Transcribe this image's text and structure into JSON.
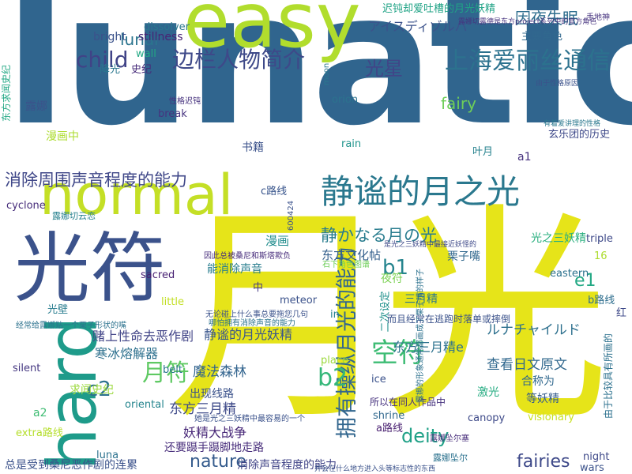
{
  "cloud": {
    "words": [
      {
        "text": "lunatic",
        "color": "#30658e",
        "rotated": false
      },
      {
        "text": "月光",
        "color": "#e6e419",
        "rotated": false
      },
      {
        "text": "easy",
        "color": "#b1dd2d",
        "rotated": false
      },
      {
        "text": "hard",
        "color": "#1e9b8a",
        "rotated": true
      },
      {
        "text": "normal",
        "color": "#c4df26",
        "rotated": false
      },
      {
        "text": "光符",
        "color": "#3b528b",
        "rotated": false
      },
      {
        "text": "静谧的月之光",
        "color": "#2a788e",
        "rotated": false
      },
      {
        "text": "拥有操纵月光的能力",
        "color": "#31668e",
        "rotated": true
      },
      {
        "text": "上海爱丽丝通信",
        "color": "#2c728e",
        "rotated": false
      },
      {
        "text": "边栏人物简介",
        "color": "#3e4989",
        "rotated": false
      },
      {
        "text": "消除周围声音程度的能力",
        "color": "#3f4788",
        "rotated": false
      },
      {
        "text": "静かなる月の光",
        "color": "#287c8e",
        "rotated": false
      },
      {
        "text": "因夜失眠",
        "color": "#2e6e8e",
        "rotated": false
      },
      {
        "text": "光星",
        "color": "#404688",
        "rotated": false
      },
      {
        "text": "空符",
        "color": "#3dbc74",
        "rotated": false
      },
      {
        "text": "月符",
        "color": "#5ec962",
        "rotated": false
      },
      {
        "text": "child",
        "color": "#404387",
        "rotated": false
      },
      {
        "text": "lunar",
        "color": "#2b748e",
        "rotated": false
      },
      {
        "text": "fairy",
        "color": "#6ece58",
        "rotated": false
      },
      {
        "text": "b1",
        "color": "#25848e",
        "rotated": false
      },
      {
        "text": "b2",
        "color": "#35b779",
        "rotated": false
      },
      {
        "text": "c2",
        "color": "#2c718e",
        "rotated": false
      },
      {
        "text": "e1",
        "color": "#22a884",
        "rotated": false
      },
      {
        "text": "deity",
        "color": "#1fa187",
        "rotated": false
      },
      {
        "text": "nature",
        "color": "#365c8d",
        "rotated": false
      },
      {
        "text": "fairies",
        "color": "#3e4989",
        "rotated": false
      },
      {
        "text": "アイスディゾルバ",
        "color": "#3b528b",
        "rotated": false
      },
      {
        "text": "ルナチャイルド",
        "color": "#2d708e",
        "rotated": false
      },
      {
        "text": "东方三月精e",
        "color": "#2c728e",
        "rotated": false
      },
      {
        "text": "东方三月精",
        "color": "#3e4a89",
        "rotated": false
      },
      {
        "text": "东方文化帖",
        "color": "#35608d",
        "rotated": false
      },
      {
        "text": "魔法森林",
        "color": "#32648e",
        "rotated": false
      },
      {
        "text": "查看日文原文",
        "color": "#31688e",
        "rotated": false
      },
      {
        "text": "静谧的月光妖精",
        "color": "#39568c",
        "rotated": false
      },
      {
        "text": "赌上性命去恶作剧",
        "color": "#414487",
        "rotated": false
      },
      {
        "text": "寒冰熔解器",
        "color": "#2d708e",
        "rotated": false
      },
      {
        "text": "妖精大战争",
        "color": "#482878",
        "rotated": false
      },
      {
        "text": "出现线路",
        "color": "#3b528b",
        "rotated": false
      },
      {
        "text": "还要蹑手蹑脚地走路",
        "color": "#472d7b",
        "rotated": false
      },
      {
        "text": "消除声音程度的能力",
        "color": "#414487",
        "rotated": false
      },
      {
        "text": "总是受到桑尼恶作剧的连累",
        "color": "#3b528b",
        "rotated": false
      },
      {
        "text": "迟钝却爱吐槽的月光妖精",
        "color": "#20a386",
        "rotated": false
      },
      {
        "text": "能消除声音",
        "color": "#287d8e",
        "rotated": false
      },
      {
        "text": "栗子嘴",
        "color": "#31688e",
        "rotated": false
      },
      {
        "text": "三月精",
        "color": "#2a768e",
        "rotated": false
      },
      {
        "text": "光之三妖精",
        "color": "#29af7f",
        "rotated": false
      },
      {
        "text": "玄乐团的历史",
        "color": "#3e4989",
        "rotated": false
      },
      {
        "text": "合称为",
        "color": "#31688e",
        "rotated": false
      },
      {
        "text": "等妖精",
        "color": "#365d8d",
        "rotated": false
      },
      {
        "text": "书籍",
        "color": "#3b528b",
        "rotated": false
      },
      {
        "text": "漫画",
        "color": "#228d8d",
        "rotated": false
      },
      {
        "text": "漫画中",
        "color": "#addc30",
        "rotated": false
      },
      {
        "text": "叶月",
        "color": "#26828e",
        "rotated": false
      },
      {
        "text": "主要角色",
        "color": "#31688e",
        "rotated": false
      },
      {
        "text": "露娜",
        "color": "#3b528b",
        "rotated": false
      },
      {
        "text": "降光",
        "color": "#2a778e",
        "rotated": false
      },
      {
        "text": "光壁",
        "color": "#287c8e",
        "rotated": false
      },
      {
        "text": "夜符",
        "color": "#7ad151",
        "rotated": false
      },
      {
        "text": "激光",
        "color": "#25ac82",
        "rotated": false
      },
      {
        "text": "求闻史纪",
        "color": "#9bd93c",
        "rotated": false
      },
      {
        "text": "史纪",
        "color": "#472c7a",
        "rotated": false
      },
      {
        "text": "二次设定",
        "color": "#21918c",
        "rotated": true
      },
      {
        "text": "a路线",
        "color": "#481f70",
        "rotated": false
      },
      {
        "text": "b路线",
        "color": "#2e6e8e",
        "rotated": false
      },
      {
        "text": "c路线",
        "color": "#39558c",
        "rotated": false
      },
      {
        "text": "extra路线",
        "color": "#b5de2b",
        "rotated": false
      },
      {
        "text": "所以在同人作品中",
        "color": "#46327e",
        "rotated": false
      },
      {
        "text": "而且经常在逃跑时落单或摔倒",
        "color": "#3b528b",
        "rotated": false
      },
      {
        "text": "露娜切云恋",
        "color": "#27808e",
        "rotated": false
      },
      {
        "text": "bright",
        "color": "#3b528b",
        "rotated": false
      },
      {
        "text": "stillness",
        "color": "#482475",
        "rotated": false
      },
      {
        "text": "dissolver",
        "color": "#2a788e",
        "rotated": false
      },
      {
        "text": "wall",
        "color": "#22a884",
        "rotated": false
      },
      {
        "text": "orion",
        "color": "#2c728e",
        "rotated": false
      },
      {
        "text": "rain",
        "color": "#1f948c",
        "rotated": false
      },
      {
        "text": "break",
        "color": "#46337f",
        "rotated": false
      },
      {
        "text": "cyclone",
        "color": "#472d7b",
        "rotated": false
      },
      {
        "text": "sacred",
        "color": "#482173",
        "rotated": false
      },
      {
        "text": "little",
        "color": "#c2df23",
        "rotated": false
      },
      {
        "text": "meteor",
        "color": "#3b528b",
        "rotated": false
      },
      {
        "text": "in",
        "color": "#26828e",
        "rotated": false
      },
      {
        "text": "place",
        "color": "#9bd93c",
        "rotated": false
      },
      {
        "text": "ice",
        "color": "#3b528b",
        "rotated": false
      },
      {
        "text": "shrine",
        "color": "#31688e",
        "rotated": false
      },
      {
        "text": "canopy",
        "color": "#3e4a89",
        "rotated": false
      },
      {
        "text": "silent",
        "color": "#453781",
        "rotated": false
      },
      {
        "text": "luna",
        "color": "#2c728e",
        "rotated": false
      },
      {
        "text": "oriental",
        "color": "#25858e",
        "rotated": false
      },
      {
        "text": "belt",
        "color": "#2a768e",
        "rotated": false
      },
      {
        "text": "eastern",
        "color": "#2c718e",
        "rotated": false
      },
      {
        "text": "visionary",
        "color": "#c8e020",
        "rotated": false
      },
      {
        "text": "night",
        "color": "#3e4989",
        "rotated": false
      },
      {
        "text": "wars",
        "color": "#3b528b",
        "rotated": false
      },
      {
        "text": "triple",
        "color": "#3e4989",
        "rotated": false
      },
      {
        "text": "a1",
        "color": "#46327e",
        "rotated": false
      },
      {
        "text": "a2",
        "color": "#3fbc73",
        "rotated": false
      },
      {
        "text": "16",
        "color": "#addc30",
        "rotated": false
      },
      {
        "text": "中",
        "color": "#443983",
        "rotated": false
      },
      {
        "text": "红",
        "color": "#3e4989",
        "rotated": false
      },
      {
        "text": "东方求闻史纪",
        "color": "#22a884",
        "rotated": true
      },
      {
        "text": "由于比较具有所画的",
        "color": "#2c718e",
        "rotated": true
      },
      {
        "text": "露娜切露德是东方project系列中的官方角色",
        "color": "#46337f",
        "rotated": false
      },
      {
        "text": "有着爱讲理的性格",
        "color": "#2a788e",
        "rotated": false
      },
      {
        "text": "是光之三妖精中最接近妖怪的",
        "color": "#3e4989",
        "rotated": false
      },
      {
        "text": "由于性格原因",
        "color": "#3b528b",
        "rotated": false
      },
      {
        "text": "因此总被桑尼和斯塔欺负",
        "color": "#472d7b",
        "rotated": false
      },
      {
        "text": "无论碰上什么事总要拖您几句",
        "color": "#3b528b",
        "rotated": false
      },
      {
        "text": "哪怕拥有消除声音的能力",
        "color": "#2c728e",
        "rotated": false
      },
      {
        "text": "石下角色图谱",
        "color": "#6ece58",
        "rotated": false
      },
      {
        "text": "她是光之三妖精中最容易的一个",
        "color": "#3b528b",
        "rotated": false
      },
      {
        "text": "经常给露娜贴一个栗子形状的嘴",
        "color": "#2c728e",
        "rotated": false
      },
      {
        "text": "露娜的形象通常都画成了栗子嘴的样子",
        "color": "#2c718e",
        "rotated": true
      },
      {
        "text": "露娜坠尔",
        "color": "#2c728e",
        "rotated": false
      },
      {
        "text": "露娜坠尔塞",
        "color": "#472d7b",
        "rotated": false
      },
      {
        "text": "并会在什么地方进入头等标志性的东西",
        "color": "#3b528b",
        "rotated": false
      },
      {
        "text": "手地神",
        "color": "#46337f",
        "rotated": false
      },
      {
        "text": "moon",
        "color": "#2a788e",
        "rotated": false
      },
      {
        "text": "性格迟钝",
        "color": "#46327e",
        "rotated": false
      },
      {
        "text": "600424",
        "color": "#3b528b",
        "rotated": true
      }
    ]
  }
}
